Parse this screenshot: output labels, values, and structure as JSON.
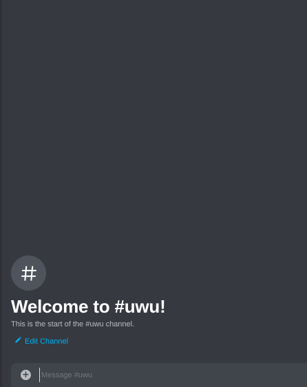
{
  "channel": {
    "name": "uwu",
    "avatar_icon": "hash-icon"
  },
  "welcome": {
    "title": "Welcome to #uwu!",
    "subtitle": "This is the start of the #uwu channel.",
    "edit_label": "Edit Channel",
    "edit_icon": "pencil-icon"
  },
  "composer": {
    "attach_icon": "plus-circle-icon",
    "placeholder": "Message #uwu",
    "value": ""
  },
  "colors": {
    "background": "#36393f",
    "composer_bg": "#40444b",
    "avatar_bg": "#4f545c",
    "link": "#00b0f4",
    "title": "#ffffff",
    "muted": "#b9bbbe"
  }
}
